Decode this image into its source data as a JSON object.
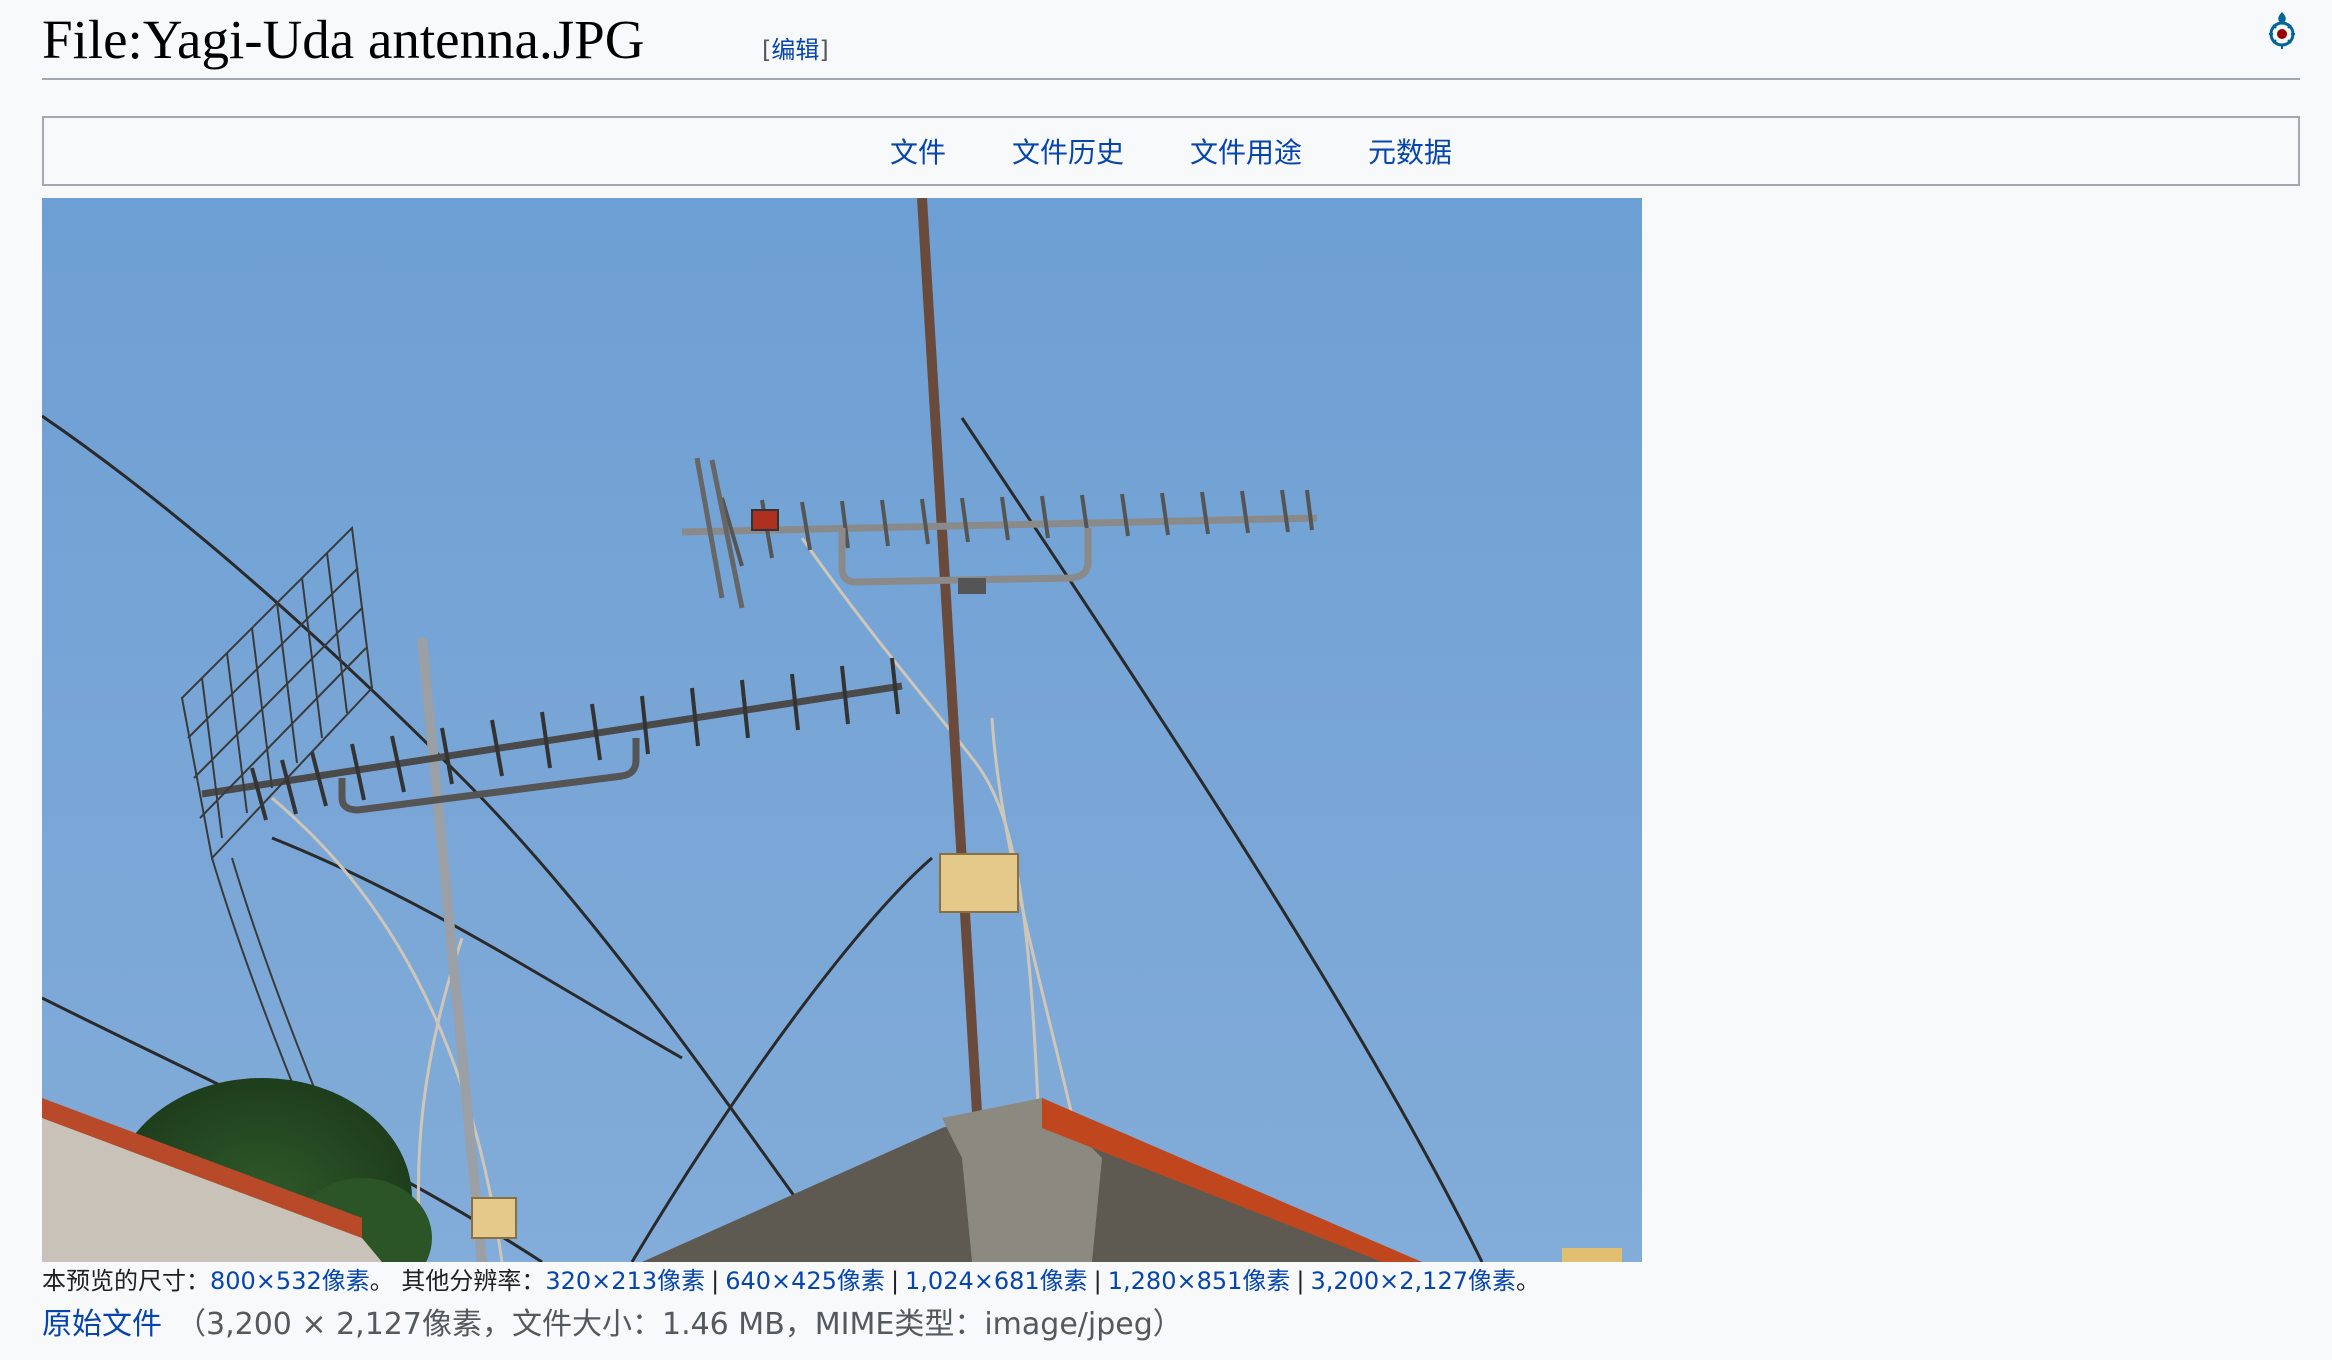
{
  "heading": {
    "title": "File:Yagi-Uda antenna.JPG",
    "edit_open": "[",
    "edit_label": "编辑",
    "edit_close": "]"
  },
  "logo": {
    "icon": "wikimedia-commons-icon"
  },
  "tabs": [
    {
      "label": "文件"
    },
    {
      "label": "文件历史"
    },
    {
      "label": "文件用途"
    },
    {
      "label": "元数据"
    }
  ],
  "image": {
    "alt": "Yagi-Uda antenna"
  },
  "preview": {
    "prefix": "本预览的尺寸：",
    "size": "800×532像素",
    "middle": "。 其他分辨率：",
    "resolutions": [
      "320×213像素",
      "640×425像素",
      "1,024×681像素",
      "1,280×851像素",
      "3,200×2,127像素"
    ],
    "separator": "|",
    "suffix": "。"
  },
  "original": {
    "link": "原始文件",
    "info": "（3,200 × 2,127像素，文件大小：1.46 MB，MIME类型：image/jpeg）"
  },
  "colors": {
    "link": "#0645ad",
    "sky": "#7aa8d8",
    "border": "#a2a9b1"
  }
}
